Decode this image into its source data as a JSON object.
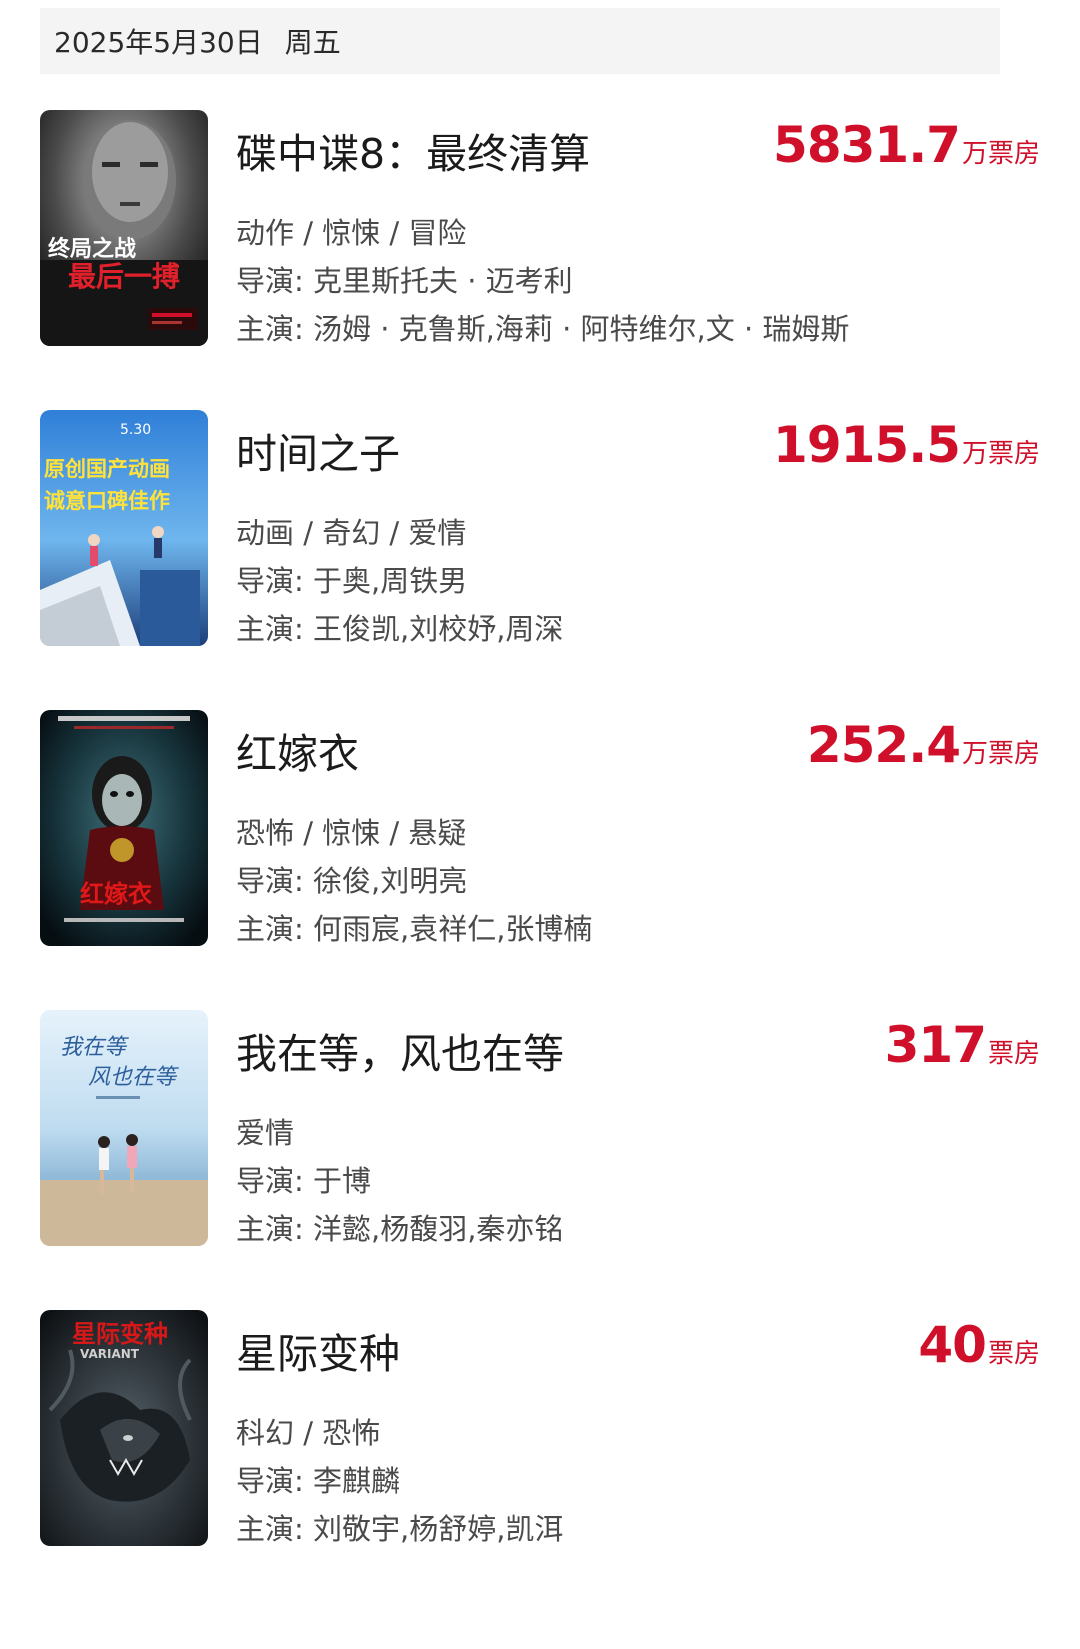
{
  "header": {
    "date": "2025年5月30日",
    "weekday": "周五"
  },
  "accent_color": "#d0102a",
  "movies": [
    {
      "title": "碟中谍8：最终清算",
      "box_office": "5831.7",
      "unit": "万票房",
      "genres": "动作 / 惊悚 / 冒险",
      "director": "导演: 克里斯托夫 · 迈考利",
      "cast": "主演: 汤姆 · 克鲁斯,海莉 · 阿特维尔,文 · 瑞姆斯",
      "poster_text": [
        "终局之战",
        "最后一搏"
      ]
    },
    {
      "title": "时间之子",
      "box_office": "1915.5",
      "unit": "万票房",
      "genres": "动画 / 奇幻 / 爱情",
      "director": "导演: 于奥,周铁男",
      "cast": "主演: 王俊凯,刘校妤,周深",
      "poster_text": [
        "原创国产动画",
        "诚意口碑佳作",
        "5.30"
      ]
    },
    {
      "title": "红嫁衣",
      "box_office": "252.4",
      "unit": "万票房",
      "genres": "恐怖 / 惊悚 / 悬疑",
      "director": "导演: 徐俊,刘明亮",
      "cast": "主演: 何雨宸,袁祥仁,张博楠",
      "poster_text": [
        "红嫁衣"
      ]
    },
    {
      "title": "我在等，风也在等",
      "box_office": "317",
      "unit": "票房",
      "genres": "爱情",
      "director": "导演: 于博",
      "cast": "主演: 洋懿,杨馥羽,秦亦铭",
      "poster_text": [
        "我在等",
        "风也在等"
      ]
    },
    {
      "title": "星际变种",
      "box_office": "40",
      "unit": "票房",
      "genres": "科幻 / 恐怖",
      "director": "导演: 李麒麟",
      "cast": "主演: 刘敬宇,杨舒婷,凯洱",
      "poster_text": [
        "星际变种",
        "VARIANT"
      ]
    }
  ]
}
